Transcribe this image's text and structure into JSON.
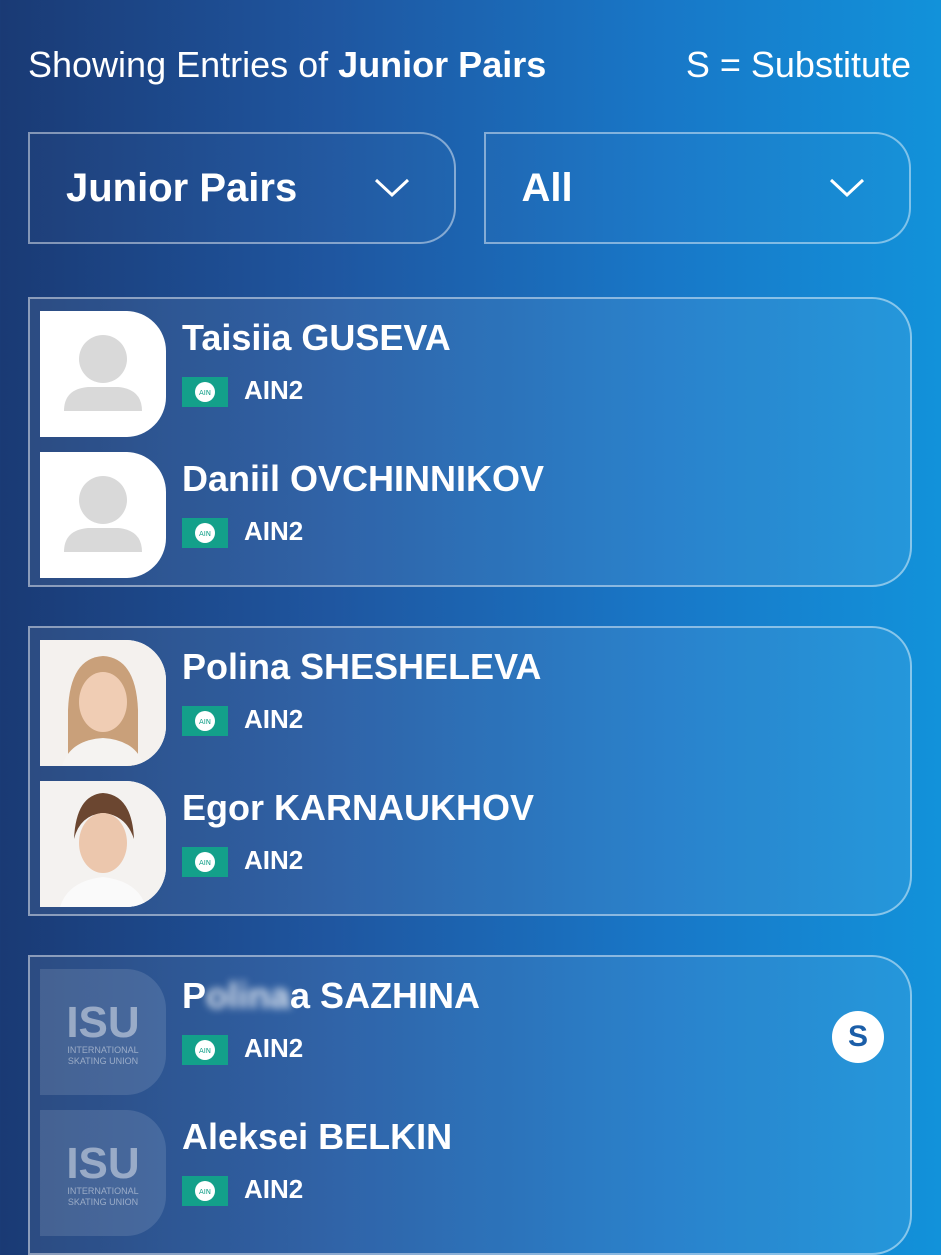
{
  "header": {
    "prefix": "Showing Entries of ",
    "category": "Junior Pairs",
    "legend": "S = Substitute"
  },
  "filters": {
    "category_value": "Junior Pairs",
    "nation_value": "All"
  },
  "entries": [
    {
      "substitute": false,
      "skaters": [
        {
          "name": "Taisiia GUSEVA",
          "nation": "AIN2",
          "photo": "placeholder"
        },
        {
          "name": "Daniil OVCHINNIKOV",
          "nation": "AIN2",
          "photo": "placeholder"
        }
      ]
    },
    {
      "substitute": false,
      "skaters": [
        {
          "name": "Polina SHESHELEVA",
          "nation": "AIN2",
          "photo": "portrait"
        },
        {
          "name": "Egor KARNAUKHOV",
          "nation": "AIN2",
          "photo": "portrait"
        }
      ]
    },
    {
      "substitute": true,
      "badge": "S",
      "skaters": [
        {
          "name_partial_start": "P",
          "name_obscured": "olina",
          "name_partial_end": "a SAZHINA",
          "nation": "AIN2",
          "photo": "isu-logo"
        },
        {
          "name": "Aleksei BELKIN",
          "nation": "AIN2",
          "photo": "isu-logo"
        }
      ]
    }
  ],
  "isu_logo": {
    "mark": "ISU",
    "line1": "INTERNATIONAL",
    "line2": "SKATING UNION"
  },
  "flag_text": "AIN",
  "colors": {
    "flag": "#13a08a",
    "badge_bg": "#ffffff",
    "badge_text": "#1b5ea8"
  }
}
